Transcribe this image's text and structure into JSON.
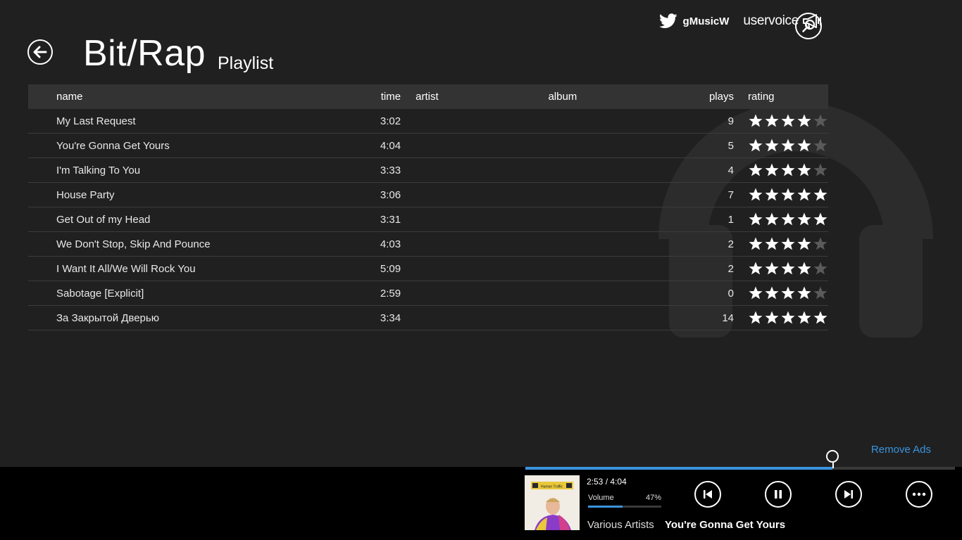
{
  "header": {
    "title": "Bit/Rap",
    "subtitle": "Playlist",
    "twitter_handle": "gMusicW",
    "uservoice_label": "uservoice"
  },
  "table": {
    "columns": [
      "name",
      "time",
      "artist",
      "album",
      "plays",
      "rating"
    ],
    "rows": [
      {
        "name": "My Last Request",
        "time": "3:02",
        "artist": "",
        "album": "",
        "plays": "9",
        "rating": 4
      },
      {
        "name": "You're Gonna Get Yours",
        "time": "4:04",
        "artist": "",
        "album": "",
        "plays": "5",
        "rating": 4
      },
      {
        "name": "I'm Talking To You",
        "time": "3:33",
        "artist": "",
        "album": "",
        "plays": "4",
        "rating": 4
      },
      {
        "name": "House Party",
        "time": "3:06",
        "artist": "",
        "album": "",
        "plays": "7",
        "rating": 5
      },
      {
        "name": "Get Out of my Head",
        "time": "3:31",
        "artist": "",
        "album": "",
        "plays": "1",
        "rating": 5
      },
      {
        "name": "We Don't Stop, Skip And Pounce",
        "time": "4:03",
        "artist": "",
        "album": "",
        "plays": "2",
        "rating": 4
      },
      {
        "name": "I Want It All/We Will Rock You",
        "time": "5:09",
        "artist": "",
        "album": "",
        "plays": "2",
        "rating": 4
      },
      {
        "name": "Sabotage [Explicit]",
        "time": "2:59",
        "artist": "",
        "album": "",
        "plays": "0",
        "rating": 4
      },
      {
        "name": "За Закрытой Дверью",
        "time": "3:34",
        "artist": "",
        "album": "",
        "plays": "14",
        "rating": 5
      }
    ]
  },
  "remove_ads": "Remove Ads",
  "player": {
    "position": "2:53",
    "separator": "/",
    "duration": "4:04",
    "progress_fraction": 0.714,
    "volume_label": "Volume",
    "volume_percent": "47%",
    "volume_fraction": 0.47,
    "artist": "Various Artists",
    "track": "You're Gonna Get Yours",
    "cover_text": "Human Traffic"
  },
  "colors": {
    "background": "#202020",
    "accent": "#3a94de",
    "player_bar": "#000000",
    "header_row": "#333333"
  },
  "icons": {
    "back": "back-arrow-icon",
    "twitter": "twitter-icon",
    "uservoice": "megaphone-icon",
    "search": "search-icon",
    "previous": "previous-icon",
    "pause": "pause-icon",
    "next": "next-icon",
    "more": "more-icon",
    "star": "star-icon"
  }
}
